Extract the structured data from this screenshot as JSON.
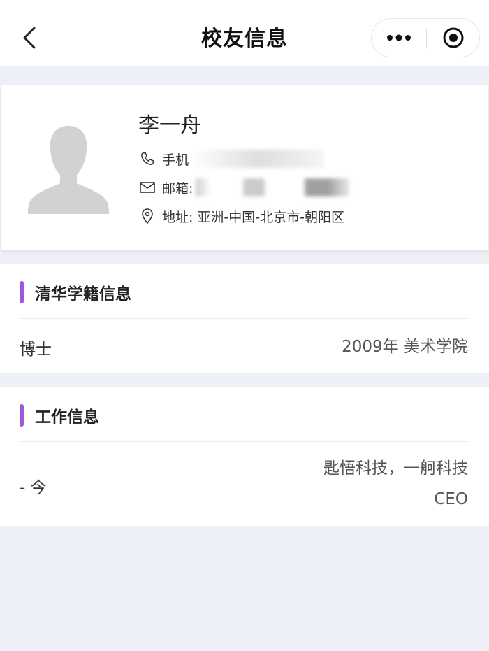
{
  "header": {
    "title": "校友信息",
    "back_icon": "chevron-left-icon",
    "more_icon": "more-dots-icon",
    "close_icon": "target-close-icon"
  },
  "profile": {
    "name": "李一舟",
    "phone_label": "手机",
    "email_label": "邮箱:",
    "address_label": "地址:",
    "address_value": "亚洲-中国-北京市-朝阳区"
  },
  "education": {
    "title": "清华学籍信息",
    "degree": "博士",
    "detail": "2009年 美术学院"
  },
  "work": {
    "title": "工作信息",
    "period": "- 今",
    "company": "匙悟科技，一舸科技",
    "position": "CEO"
  },
  "colors": {
    "accent": "#9b59d9",
    "background": "#eef0f8"
  }
}
